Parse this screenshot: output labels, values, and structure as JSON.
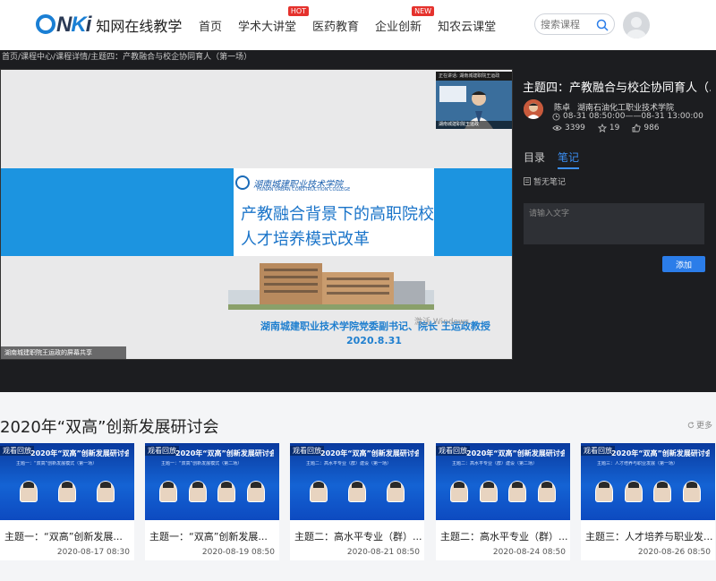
{
  "header": {
    "logo_mark": "CNKI",
    "logo_text": "知网在线教学",
    "nav": [
      {
        "label": "首页",
        "badge": ""
      },
      {
        "label": "学术大讲堂",
        "badge": "HOT"
      },
      {
        "label": "医药教育",
        "badge": ""
      },
      {
        "label": "企业创新",
        "badge": "NEW"
      },
      {
        "label": "知农云课堂",
        "badge": ""
      }
    ],
    "search_placeholder": "搜索课程"
  },
  "breadcrumb": "首页/课程中心/课程详情/主题四：产教融合与校企协同育人（第一场）",
  "video": {
    "pip_header": "正在讲话: 湖南城建职院王运政",
    "pip_name": "湖南城建职院王运政",
    "slide_school_cn": "湖南城建职业技术学院",
    "slide_school_en": "HUNAN URBAN CONSTRUCTION COLLEGE",
    "slide_title": "产教融合背景下的高职院校人才培养模式改革",
    "slide_speaker": "湖南城建职业技术学院党委副书记、院长  王运政教授",
    "slide_date": "2020.8.31",
    "watermark": "激活 Windows",
    "share_bar": "湖南城建职院王运政的屏幕共享"
  },
  "panel": {
    "title": "主题四：产教融合与校企协同育人（...",
    "lecturer_name": "陈卓",
    "lecturer_org": "湖南石油化工职业技术学院",
    "time": "08-31 08:50:00——08-31 13:00:00",
    "views": "3399",
    "stars": "19",
    "likes": "986",
    "tabs": [
      "目录",
      "笔记"
    ],
    "active_tab": 1,
    "no_note": "暂无笔记",
    "note_placeholder": "请输入文字",
    "add_button": "添加"
  },
  "section": {
    "title": "2020年“双高”创新发展研讨会",
    "more": "更多"
  },
  "cards": [
    {
      "tag": "观看回放",
      "banner": "2020年“双高”创新发展研讨会",
      "sub": "主题一：“双高”创新发展模式（第一场）",
      "title": "主题一：“双高”创新发展...",
      "date": "2020-08-17 08:30"
    },
    {
      "tag": "观看回放",
      "banner": "2020年“双高”创新发展研讨会",
      "sub": "主题一：“双高”创新发展模式（第二场）",
      "title": "主题一：“双高”创新发展...",
      "date": "2020-08-19 08:50"
    },
    {
      "tag": "观看回放",
      "banner": "2020年“双高”创新发展研讨会",
      "sub": "主题二：高水平专业（群）建设（第一场）",
      "title": "主题二：高水平专业（群）...",
      "date": "2020-08-21 08:50"
    },
    {
      "tag": "观看回放",
      "banner": "2020年“双高”创新发展研讨会",
      "sub": "主题二：高水平专业（群）建设（第二场）",
      "title": "主题二：高水平专业（群）...",
      "date": "2020-08-24 08:50"
    },
    {
      "tag": "观看回放",
      "banner": "2020年“双高”创新发展研讨会",
      "sub": "主题三：人才培养与职业发展（第一场）",
      "title": "主题三：人才培养与职业发...",
      "date": "2020-08-26 08:50"
    }
  ],
  "colors": {
    "accent": "#2b7de9",
    "dark_bg": "#1c1d20",
    "slide_blue": "#1c94e0",
    "badge_red": "#e5322d"
  },
  "icons": {
    "search": "search-icon",
    "eye": "eye-icon",
    "star": "star-icon",
    "thumb": "thumb-up-icon",
    "refresh": "refresh-icon"
  }
}
